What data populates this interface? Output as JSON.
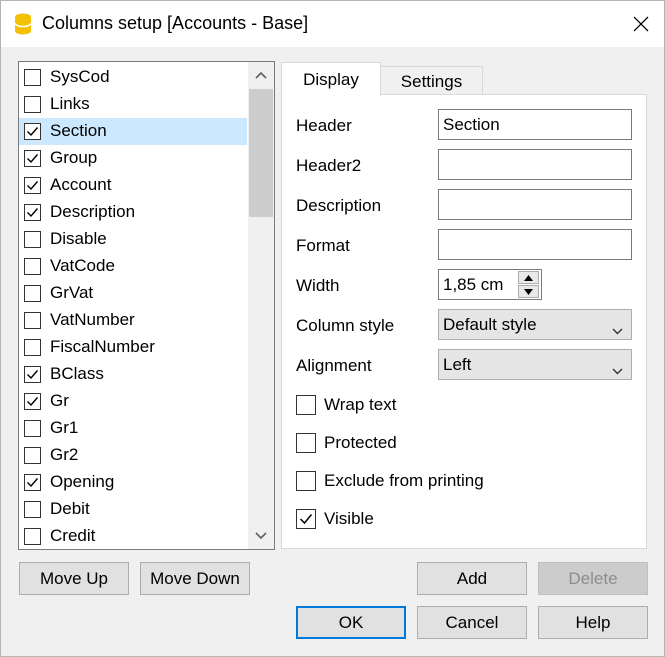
{
  "window": {
    "title": "Columns setup [Accounts - Base]",
    "app_icon": "banana-db-icon",
    "close_icon": "close-icon"
  },
  "columns_list": {
    "items": [
      {
        "label": "SysCod",
        "checked": false,
        "selected": false
      },
      {
        "label": "Links",
        "checked": false,
        "selected": false
      },
      {
        "label": "Section",
        "checked": true,
        "selected": true
      },
      {
        "label": "Group",
        "checked": true,
        "selected": false
      },
      {
        "label": "Account",
        "checked": true,
        "selected": false
      },
      {
        "label": "Description",
        "checked": true,
        "selected": false
      },
      {
        "label": "Disable",
        "checked": false,
        "selected": false
      },
      {
        "label": "VatCode",
        "checked": false,
        "selected": false
      },
      {
        "label": "GrVat",
        "checked": false,
        "selected": false
      },
      {
        "label": "VatNumber",
        "checked": false,
        "selected": false
      },
      {
        "label": "FiscalNumber",
        "checked": false,
        "selected": false
      },
      {
        "label": "BClass",
        "checked": true,
        "selected": false
      },
      {
        "label": "Gr",
        "checked": true,
        "selected": false
      },
      {
        "label": "Gr1",
        "checked": false,
        "selected": false
      },
      {
        "label": "Gr2",
        "checked": false,
        "selected": false
      },
      {
        "label": "Opening",
        "checked": true,
        "selected": false
      },
      {
        "label": "Debit",
        "checked": false,
        "selected": false
      },
      {
        "label": "Credit",
        "checked": false,
        "selected": false
      }
    ]
  },
  "tabs": [
    {
      "label": "Display",
      "active": true
    },
    {
      "label": "Settings",
      "active": false
    }
  ],
  "display": {
    "header_label": "Header",
    "header_value": "Section",
    "header2_label": "Header2",
    "header2_value": "",
    "description_label": "Description",
    "description_value": "",
    "format_label": "Format",
    "format_value": "",
    "width_label": "Width",
    "width_value": "1,85 cm",
    "column_style_label": "Column style",
    "column_style_value": "Default style",
    "alignment_label": "Alignment",
    "alignment_value": "Left",
    "options": [
      {
        "label": "Wrap text",
        "checked": false
      },
      {
        "label": "Protected",
        "checked": false
      },
      {
        "label": "Exclude from printing",
        "checked": false
      },
      {
        "label": "Visible",
        "checked": true
      }
    ]
  },
  "buttons": {
    "move_up": "Move Up",
    "move_down": "Move Down",
    "add": "Add",
    "delete": "Delete",
    "ok": "OK",
    "cancel": "Cancel",
    "help": "Help"
  },
  "colors": {
    "selection": "#cce8ff",
    "default_button_border": "#0078d7",
    "app_icon": "#f5c000"
  }
}
